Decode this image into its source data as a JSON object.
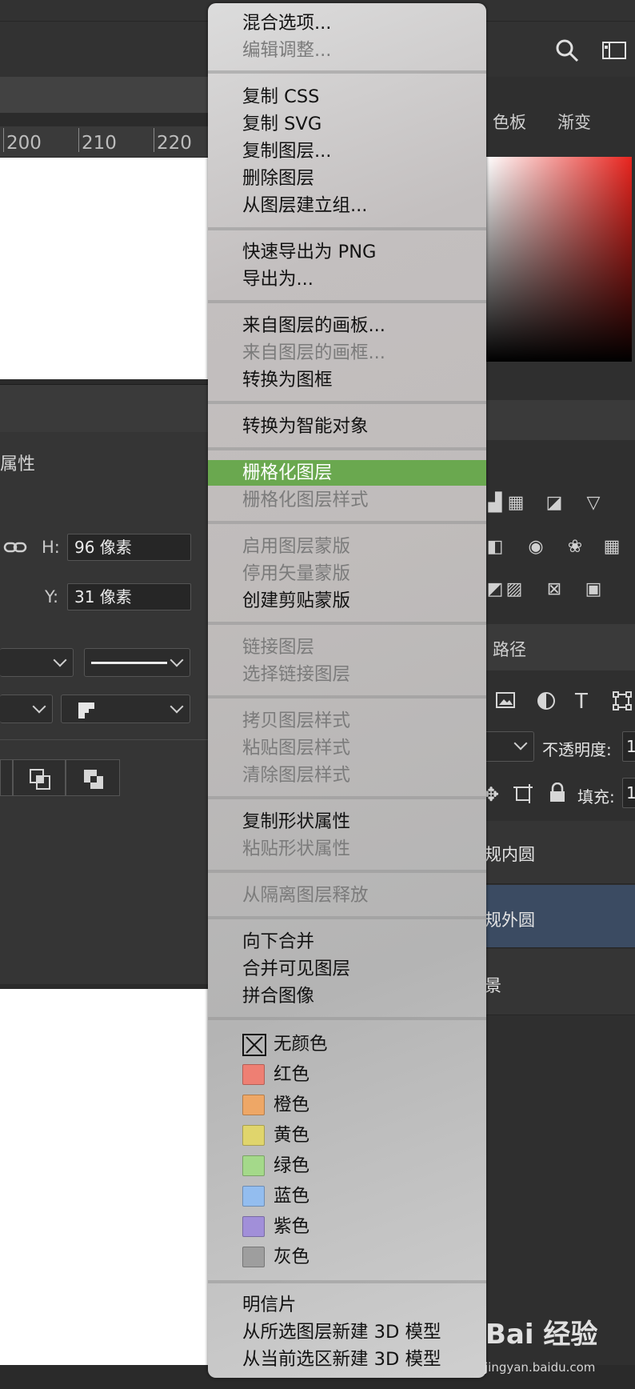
{
  "ruler": {
    "labels": [
      "200",
      "210",
      "220"
    ]
  },
  "properties": {
    "title": "属性",
    "h_label": "H:",
    "h_value": "96 像素",
    "y_label": "Y:",
    "y_value": "31 像素"
  },
  "right_panel": {
    "tabs": [
      "色板",
      "渐变"
    ],
    "layers_tab": "路径",
    "opacity_label": "不透明度:",
    "opacity_value": "1",
    "fill_label": "填充:",
    "fill_value": "1",
    "layers": [
      {
        "name": "规内圆",
        "selected": false
      },
      {
        "name": "规外圆",
        "selected": true
      },
      {
        "name": "景",
        "selected": false
      }
    ]
  },
  "menu": {
    "items": [
      {
        "label": "混合选项...",
        "disabled": false
      },
      {
        "label": "编辑调整...",
        "disabled": true
      },
      {
        "label": "复制 CSS",
        "disabled": false
      },
      {
        "label": "复制 SVG",
        "disabled": false
      },
      {
        "label": "复制图层...",
        "disabled": false
      },
      {
        "label": "删除图层",
        "disabled": false
      },
      {
        "label": "从图层建立组...",
        "disabled": false
      },
      {
        "label": "快速导出为 PNG",
        "disabled": false
      },
      {
        "label": "导出为...",
        "disabled": false
      },
      {
        "label": "来自图层的画板...",
        "disabled": false
      },
      {
        "label": "来自图层的画框...",
        "disabled": true
      },
      {
        "label": "转换为图框",
        "disabled": false
      },
      {
        "label": "转换为智能对象",
        "disabled": false
      },
      {
        "label": "栅格化图层",
        "disabled": false,
        "highlighted": true
      },
      {
        "label": "栅格化图层样式",
        "disabled": true
      },
      {
        "label": "启用图层蒙版",
        "disabled": true
      },
      {
        "label": "停用矢量蒙版",
        "disabled": true
      },
      {
        "label": "创建剪贴蒙版",
        "disabled": false
      },
      {
        "label": "链接图层",
        "disabled": true
      },
      {
        "label": "选择链接图层",
        "disabled": true
      },
      {
        "label": "拷贝图层样式",
        "disabled": true
      },
      {
        "label": "粘贴图层样式",
        "disabled": true
      },
      {
        "label": "清除图层样式",
        "disabled": true
      },
      {
        "label": "复制形状属性",
        "disabled": false
      },
      {
        "label": "粘贴形状属性",
        "disabled": true
      },
      {
        "label": "从隔离图层释放",
        "disabled": true
      },
      {
        "label": "向下合并",
        "disabled": false
      },
      {
        "label": "合并可见图层",
        "disabled": false
      },
      {
        "label": "拼合图像",
        "disabled": false
      }
    ],
    "colors": [
      {
        "label": "无颜色",
        "color": "none"
      },
      {
        "label": "红色",
        "color": "#ee7f73"
      },
      {
        "label": "橙色",
        "color": "#eea766"
      },
      {
        "label": "黄色",
        "color": "#e0d56c"
      },
      {
        "label": "绿色",
        "color": "#a4d98a"
      },
      {
        "label": "蓝色",
        "color": "#93bdef"
      },
      {
        "label": "紫色",
        "color": "#a18fd9"
      },
      {
        "label": "灰色",
        "color": "#9e9e9e"
      }
    ],
    "bottom_items": [
      {
        "label": "明信片",
        "disabled": false
      },
      {
        "label": "从所选图层新建 3D 模型",
        "disabled": false
      },
      {
        "label": "从当前选区新建 3D 模型",
        "disabled": false
      }
    ]
  },
  "watermark": {
    "text": "Bai 经验",
    "sub": "jingyan.baidu.com"
  }
}
